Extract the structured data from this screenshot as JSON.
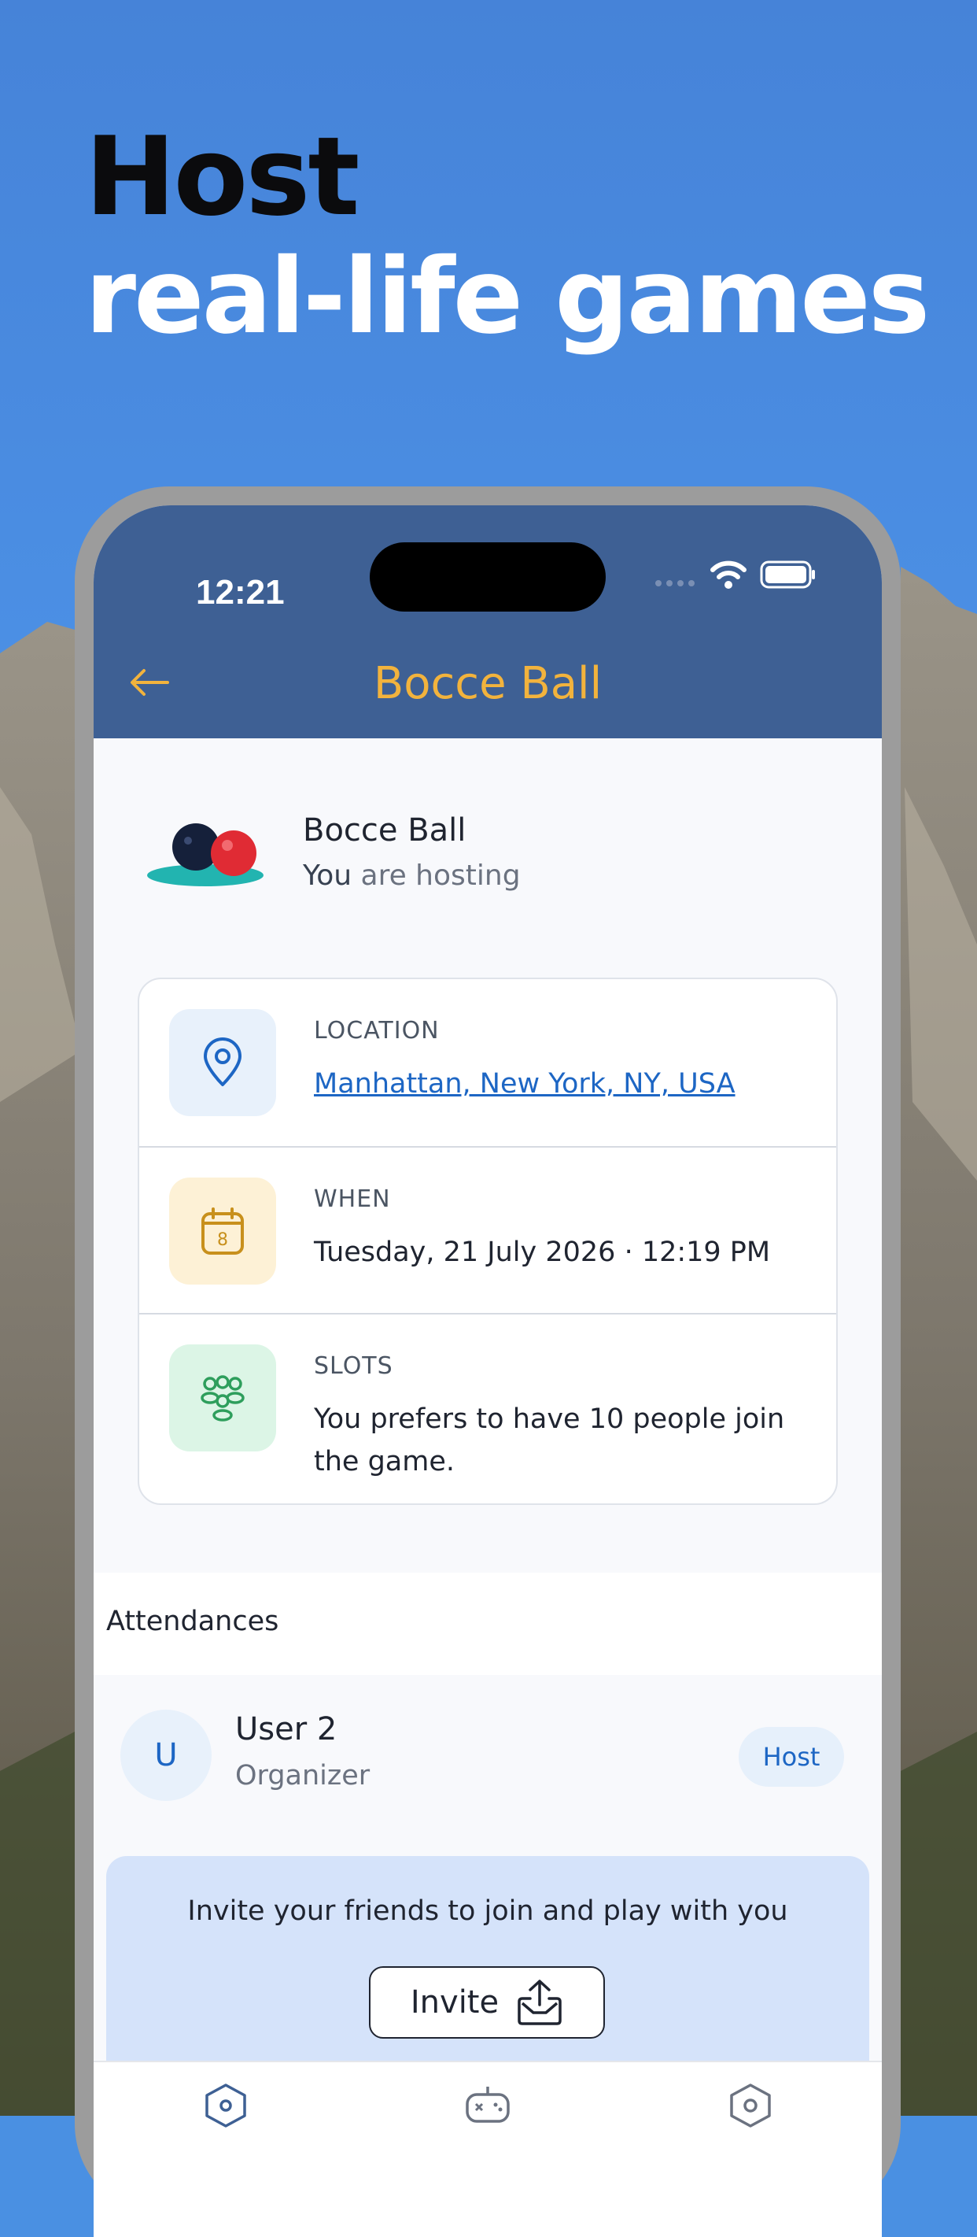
{
  "headline": {
    "line1": "Host",
    "line2": "real-life games"
  },
  "status_bar": {
    "time": "12:21"
  },
  "nav": {
    "title": "Bocce Ball",
    "back_icon": "arrow-left-icon"
  },
  "game": {
    "name": "Bocce Ball",
    "host_subject": "You",
    "host_text": " are hosting",
    "art_icon": "bocce-balls-icon"
  },
  "details": {
    "location": {
      "label": "LOCATION",
      "value": "Manhattan, New York, NY, USA",
      "icon": "map-pin-icon"
    },
    "when": {
      "label": "WHEN",
      "value": "Tuesday, 21 July 2026 · 12:19 PM",
      "icon": "calendar-icon",
      "icon_day": "8"
    },
    "slots": {
      "label": "SLOTS",
      "value": "You  prefers to have 10  people join the game.",
      "icon": "people-group-icon"
    }
  },
  "attendances": {
    "title": "Attendances",
    "items": [
      {
        "initial": "U",
        "name": "User 2",
        "role": "Organizer",
        "badge": "Host"
      }
    ]
  },
  "invite": {
    "prompt": "Invite your friends to join and play with you",
    "button_label": "Invite",
    "button_icon": "share-upload-icon"
  },
  "tabbar": {
    "items": [
      {
        "icon": "home-hexagon-icon"
      },
      {
        "icon": "gamepad-icon"
      },
      {
        "icon": "settings-hexagon-icon"
      }
    ]
  },
  "colors": {
    "header_bg": "#3e6094",
    "title_accent": "#f2b33d",
    "link": "#1d66c4",
    "invite_bg": "#d5e3fa",
    "location_tile": "#e8f1fb",
    "when_tile": "#fdf1d6",
    "slots_tile": "#dcf5e6"
  }
}
